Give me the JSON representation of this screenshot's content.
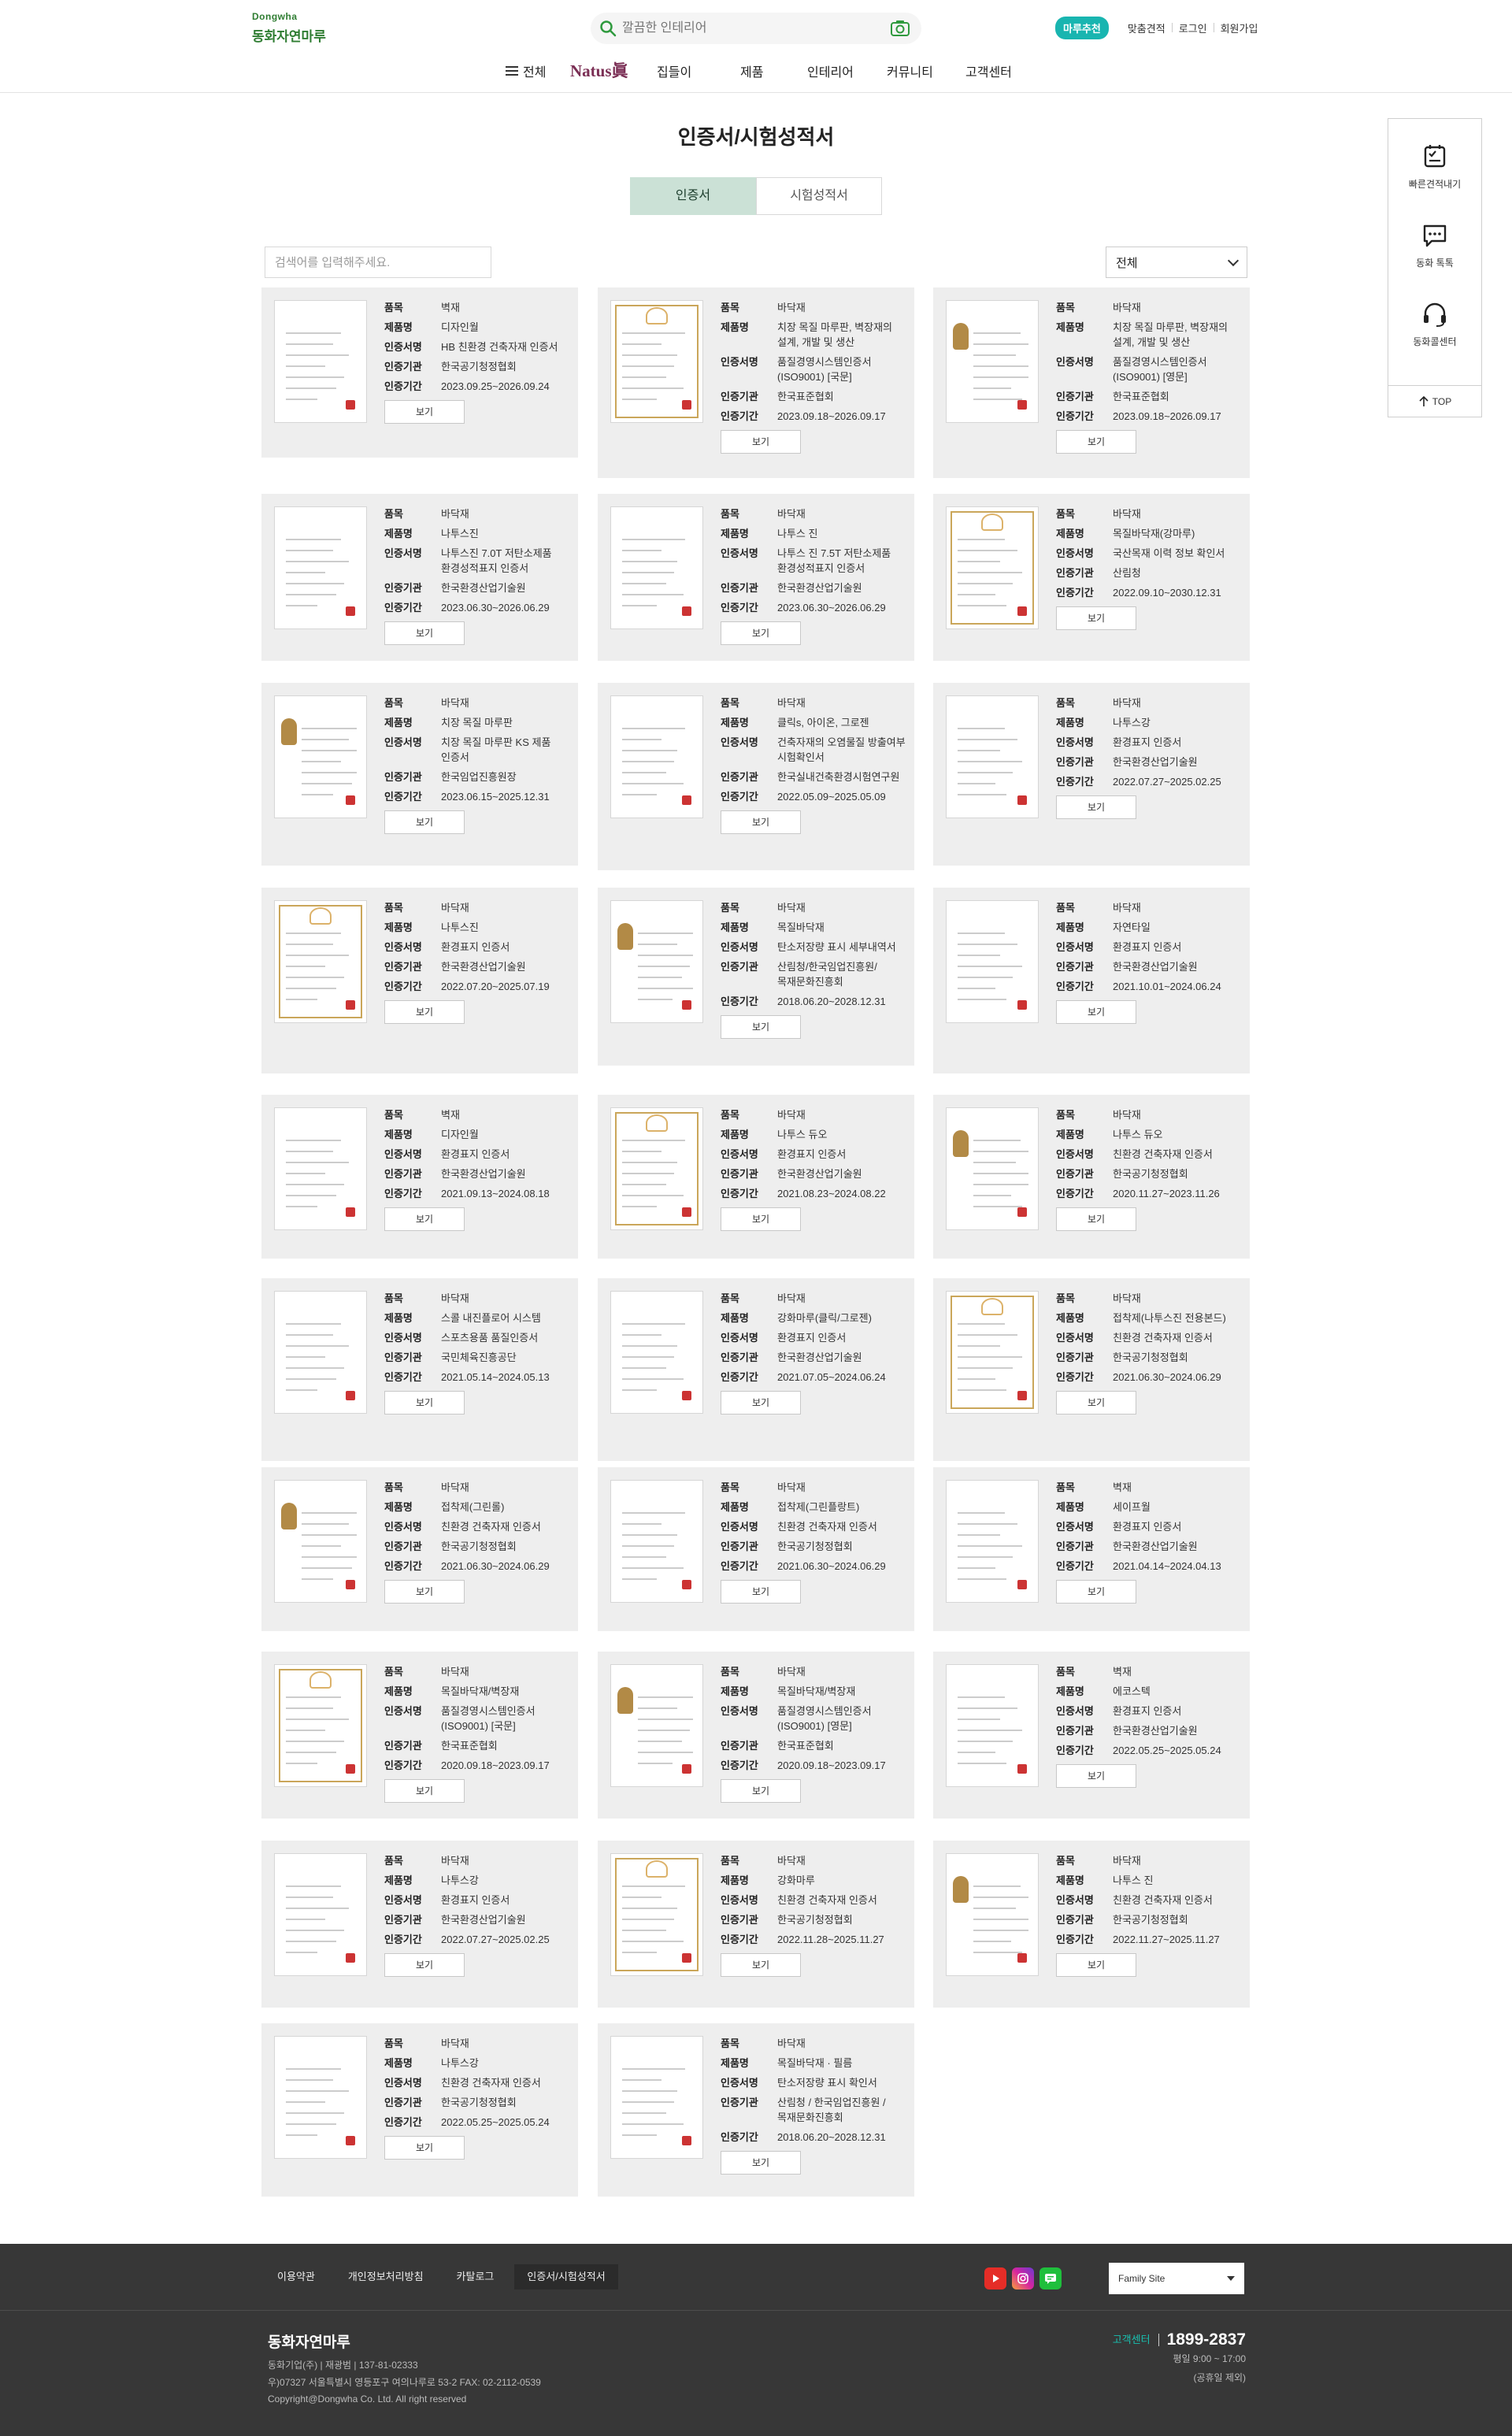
{
  "header": {
    "logo_en": "Dongwha",
    "logo_ko": "동화자연마루",
    "search_placeholder": "깔끔한 인테리어",
    "util": {
      "pill": "마루추천",
      "estimate": "맞춤견적",
      "login": "로그인",
      "join": "회원가입"
    },
    "gnb": {
      "all": "전체",
      "natus": "Natus眞",
      "items": [
        "집들이",
        "제품",
        "인테리어",
        "커뮤니티",
        "고객센터"
      ]
    }
  },
  "page": {
    "title": "인증서/시험성적서",
    "tabs": [
      "인증서",
      "시험성적서"
    ],
    "search_placeholder": "검색어를 입력해주세요.",
    "filter_selected": "전체"
  },
  "labels": {
    "item": "품목",
    "product": "제품명",
    "cert": "인증서명",
    "org": "인증기관",
    "period": "인증기간",
    "view": "보기"
  },
  "colors": {
    "brand": "#2f7d32",
    "accent": "#19b5b0",
    "tab_active": "#cbe1d6",
    "card_bg": "#eeeeee",
    "footer": "#373737"
  },
  "cards": [
    {
      "item": "벽재",
      "product": "디자인월",
      "cert": "HB 친환경 건축자재 인증서",
      "org": "한국공기청정협회",
      "period": "2023.09.25~2026.09.24"
    },
    {
      "item": "바닥재",
      "product": "치장 목질 마루판, 벽장재의 설계, 개발 및 생산",
      "cert": "품질경영시스템인증서(ISO9001) [국문]",
      "org": "한국표준협회",
      "period": "2023.09.18~2026.09.17"
    },
    {
      "item": "바닥재",
      "product": "치장 목질 마루판, 벽장재의 설계, 개발 및 생산",
      "cert": "품질경영시스템인증서(ISO9001) [영문]",
      "org": "한국표준협회",
      "period": "2023.09.18~2026.09.17"
    },
    {
      "item": "바닥재",
      "product": "나투스진",
      "cert": "나투스진 7.0T 저탄소제품 환경성적표지 인증서",
      "org": "한국환경산업기술원",
      "period": "2023.06.30~2026.06.29"
    },
    {
      "item": "바닥재",
      "product": "나투스 진",
      "cert": "나투스 진 7.5T 저탄소제품 환경성적표지 인증서",
      "org": "한국환경산업기술원",
      "period": "2023.06.30~2026.06.29"
    },
    {
      "item": "바닥재",
      "product": "목질바닥재(강마루)",
      "cert": "국산목재 이력 정보 확인서",
      "org": "산림청",
      "period": "2022.09.10~2030.12.31"
    },
    {
      "item": "바닥재",
      "product": "치장 목질 마루판",
      "cert": "치장 목질 마루판 KS 제품 인증서",
      "org": "한국임업진흥원장",
      "period": "2023.06.15~2025.12.31"
    },
    {
      "item": "바닥재",
      "product": "클릭s, 아이온, 그로젠",
      "cert": "건축자재의 오염물질 방출여부 시험확인서",
      "org": "한국실내건축환경시험연구원",
      "period": "2022.05.09~2025.05.09"
    },
    {
      "item": "바닥재",
      "product": "나투스강",
      "cert": "환경표지 인증서",
      "org": "한국환경산업기술원",
      "period": "2022.07.27~2025.02.25"
    },
    {
      "item": "바닥재",
      "product": "나투스진",
      "cert": "환경표지 인증서",
      "org": "한국환경산업기술원",
      "period": "2022.07.20~2025.07.19"
    },
    {
      "item": "바닥재",
      "product": "목질바닥재",
      "cert": "탄소저장량 표시 세부내역서",
      "org": "산림청/한국임업진흥원/목재문화진흥회",
      "period": "2018.06.20~2028.12.31"
    },
    {
      "item": "바닥재",
      "product": "자연타일",
      "cert": "환경표지 인증서",
      "org": "한국환경산업기술원",
      "period": "2021.10.01~2024.06.24"
    },
    {
      "item": "벽재",
      "product": "디자인월",
      "cert": "환경표지 인증서",
      "org": "한국환경산업기술원",
      "period": "2021.09.13~2024.08.18"
    },
    {
      "item": "바닥재",
      "product": "나투스 듀오",
      "cert": "환경표지 인증서",
      "org": "한국환경산업기술원",
      "period": "2021.08.23~2024.08.22"
    },
    {
      "item": "바닥재",
      "product": "나투스 듀오",
      "cert": "친환경 건축자재 인증서",
      "org": "한국공기청정협회",
      "period": "2020.11.27~2023.11.26"
    },
    {
      "item": "바닥재",
      "product": "스콜 내진플로어 시스템",
      "cert": "스포츠용품 품질인증서",
      "org": "국민체육진흥공단",
      "period": "2021.05.14~2024.05.13"
    },
    {
      "item": "바닥재",
      "product": "강화마루(클릭/그로젠)",
      "cert": "환경표지 인증서",
      "org": "한국환경산업기술원",
      "period": "2021.07.05~2024.06.24"
    },
    {
      "item": "바닥재",
      "product": "접착제(나투스진 전용본드)",
      "cert": "친환경 건축자재 인증서",
      "org": "한국공기청정협회",
      "period": "2021.06.30~2024.06.29"
    },
    {
      "item": "바닥재",
      "product": "접착제(그린롤)",
      "cert": "친환경 건축자재 인증서",
      "org": "한국공기청정협회",
      "period": "2021.06.30~2024.06.29"
    },
    {
      "item": "바닥재",
      "product": "접착제(그린플랑트)",
      "cert": "친환경 건축자재 인증서",
      "org": "한국공기청정협회",
      "period": "2021.06.30~2024.06.29"
    },
    {
      "item": "벽재",
      "product": "세이프월",
      "cert": "환경표지 인증서",
      "org": "한국환경산업기술원",
      "period": "2021.04.14~2024.04.13"
    },
    {
      "item": "바닥재",
      "product": "목질바닥재/벽장재",
      "cert": "품질경영시스템인증서(ISO9001) [국문]",
      "org": "한국표준협회",
      "period": "2020.09.18~2023.09.17"
    },
    {
      "item": "바닥재",
      "product": "목질바닥재/벽장재",
      "cert": "품질경영시스템인증서(ISO9001) [영문]",
      "org": "한국표준협회",
      "period": "2020.09.18~2023.09.17"
    },
    {
      "item": "벽재",
      "product": "에코스텍",
      "cert": "환경표지 인증서",
      "org": "한국환경산업기술원",
      "period": "2022.05.25~2025.05.24"
    },
    {
      "item": "바닥재",
      "product": "나투스강",
      "cert": "환경표지 인증서",
      "org": "한국환경산업기술원",
      "period": "2022.07.27~2025.02.25"
    },
    {
      "item": "바닥재",
      "product": "강화마루",
      "cert": "친환경 건축자재 인증서",
      "org": "한국공기청정협회",
      "period": "2022.11.28~2025.11.27"
    },
    {
      "item": "바닥재",
      "product": "나투스 진",
      "cert": "친환경 건축자재 인증서",
      "org": "한국공기청정협회",
      "period": "2022.11.27~2025.11.27"
    },
    {
      "item": "바닥재",
      "product": "나투스강",
      "cert": "친환경 건축자재 인증서",
      "org": "한국공기청정협회",
      "period": "2022.05.25~2025.05.24"
    },
    {
      "item": "바닥재",
      "product": "목질바닥재 · 필름",
      "cert": "탄소저장량 표시 확인서",
      "org": "산림청 / 한국임업진흥원 / 목재문화진흥회",
      "period": "2018.06.20~2028.12.31"
    }
  ],
  "quick_menu": {
    "items": [
      "빠른견적내기",
      "동화 톡톡",
      "동화콜센터"
    ],
    "top": "TOP"
  },
  "footer": {
    "nav": [
      "이용약관",
      "개인정보처리방침",
      "카탈로그",
      "인증서/시험성적서"
    ],
    "family": "Family Site",
    "company": "동화자연마루",
    "info1": "동화기업(주) | 재광범 | 137-81-02333",
    "info2": "우)07327 서울특별시 영등포구 여의나루로 53-2    FAX: 02-2112-0539",
    "copy": "Copyright@Dongwha Co. Ltd. All right reserved",
    "cs_label": "고객센터",
    "tel": "1899-2837",
    "hours": "평일 9:00 ~ 17:00",
    "holiday": "(공휴일 제외)"
  }
}
